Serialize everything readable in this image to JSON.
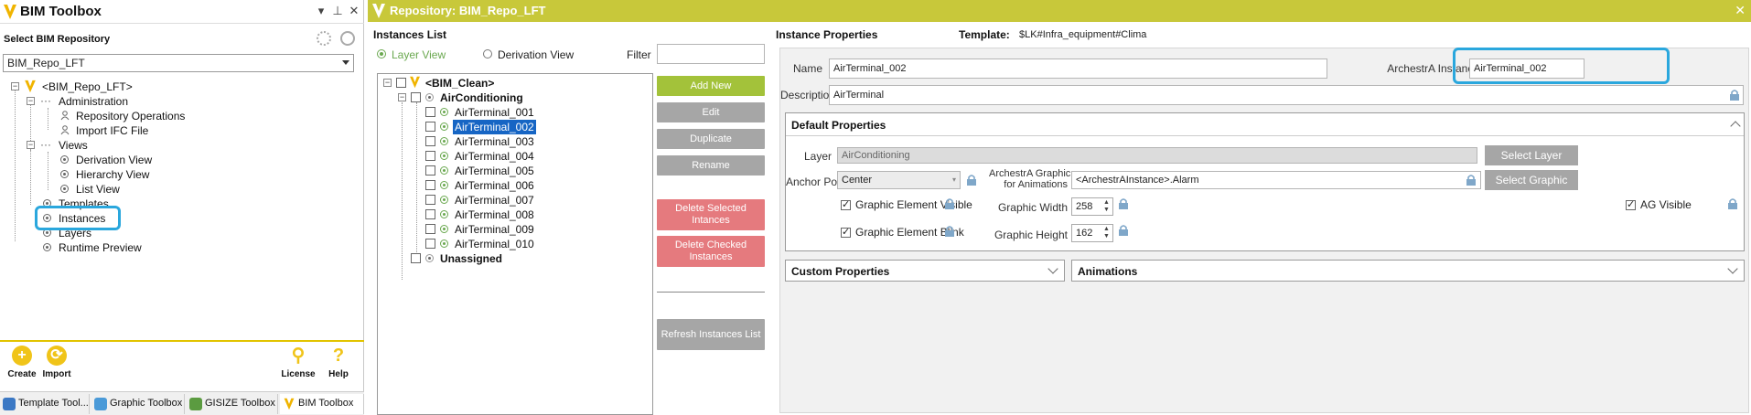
{
  "left_panel": {
    "title": "BIM Toolbox",
    "section_label": "Select BIM Repository",
    "repo_selected": "BIM_Repo_LFT",
    "tree": {
      "root": "<BIM_Repo_LFT>",
      "administration": "Administration",
      "repository_operations": "Repository Operations",
      "import_ifc": "Import IFC File",
      "views": "Views",
      "derivation_view": "Derivation View",
      "hierarchy_view": "Hierarchy View",
      "list_view": "List View",
      "templates": "Templates",
      "instances": "Instances",
      "layers": "Layers",
      "runtime_preview": "Runtime Preview"
    },
    "bottom_buttons": {
      "create": "Create",
      "import": "Import",
      "license": "License",
      "help": "Help"
    },
    "tabs": [
      "Template Tool...",
      "Graphic Toolbox",
      "GISIZE Toolbox",
      "BIM Toolbox"
    ]
  },
  "main": {
    "title": "Repository: BIM_Repo_LFT",
    "instances_list": {
      "title": "Instances List",
      "layer_view": "Layer View",
      "derivation_view": "Derivation View",
      "filter_label": "Filter",
      "filter_value": "",
      "root": "<BIM_Clean>",
      "group": "AirConditioning",
      "items": [
        "AirTerminal_001",
        "AirTerminal_002",
        "AirTerminal_003",
        "AirTerminal_004",
        "AirTerminal_005",
        "AirTerminal_006",
        "AirTerminal_007",
        "AirTerminal_008",
        "AirTerminal_009",
        "AirTerminal_010"
      ],
      "selected_item": "AirTerminal_002",
      "unassigned": "Unassigned"
    },
    "buttons": {
      "add_new": "Add New",
      "edit": "Edit",
      "duplicate": "Duplicate",
      "rename": "Rename",
      "delete_selected": "Delete Selected Intances",
      "delete_checked": "Delete Checked Instances",
      "refresh": "Refresh Instances List"
    },
    "instance_properties": {
      "title": "Instance Properties",
      "template_label": "Template:",
      "template_value": "$LK#Infra_equipment#Clima",
      "name_label": "Name",
      "name_value": "AirTerminal_002",
      "archestra_label": "ArchestrA Instance",
      "archestra_value": "AirTerminal_002",
      "description_label": "Description",
      "description_value": "AirTerminal"
    },
    "default_properties": {
      "title": "Default Properties",
      "layer_label": "Layer",
      "layer_value": "AirConditioning",
      "select_layer": "Select Layer",
      "anchor_label": "Anchor Point",
      "anchor_value": "Center",
      "graphic_label_1": "ArchestrA Graphic",
      "graphic_label_2": "for Animations",
      "graphic_value": "<ArchestrAInstance>.Alarm",
      "select_graphic": "Select Graphic",
      "visible_label": "Graphic Element Visible",
      "blink_label": "Graphic Element Blink",
      "width_label": "Graphic Width",
      "width_value": "258",
      "height_label": "Graphic Height",
      "height_value": "162",
      "ag_visible_label": "AG Visible"
    },
    "custom_properties": "Custom Properties",
    "animations": "Animations"
  }
}
